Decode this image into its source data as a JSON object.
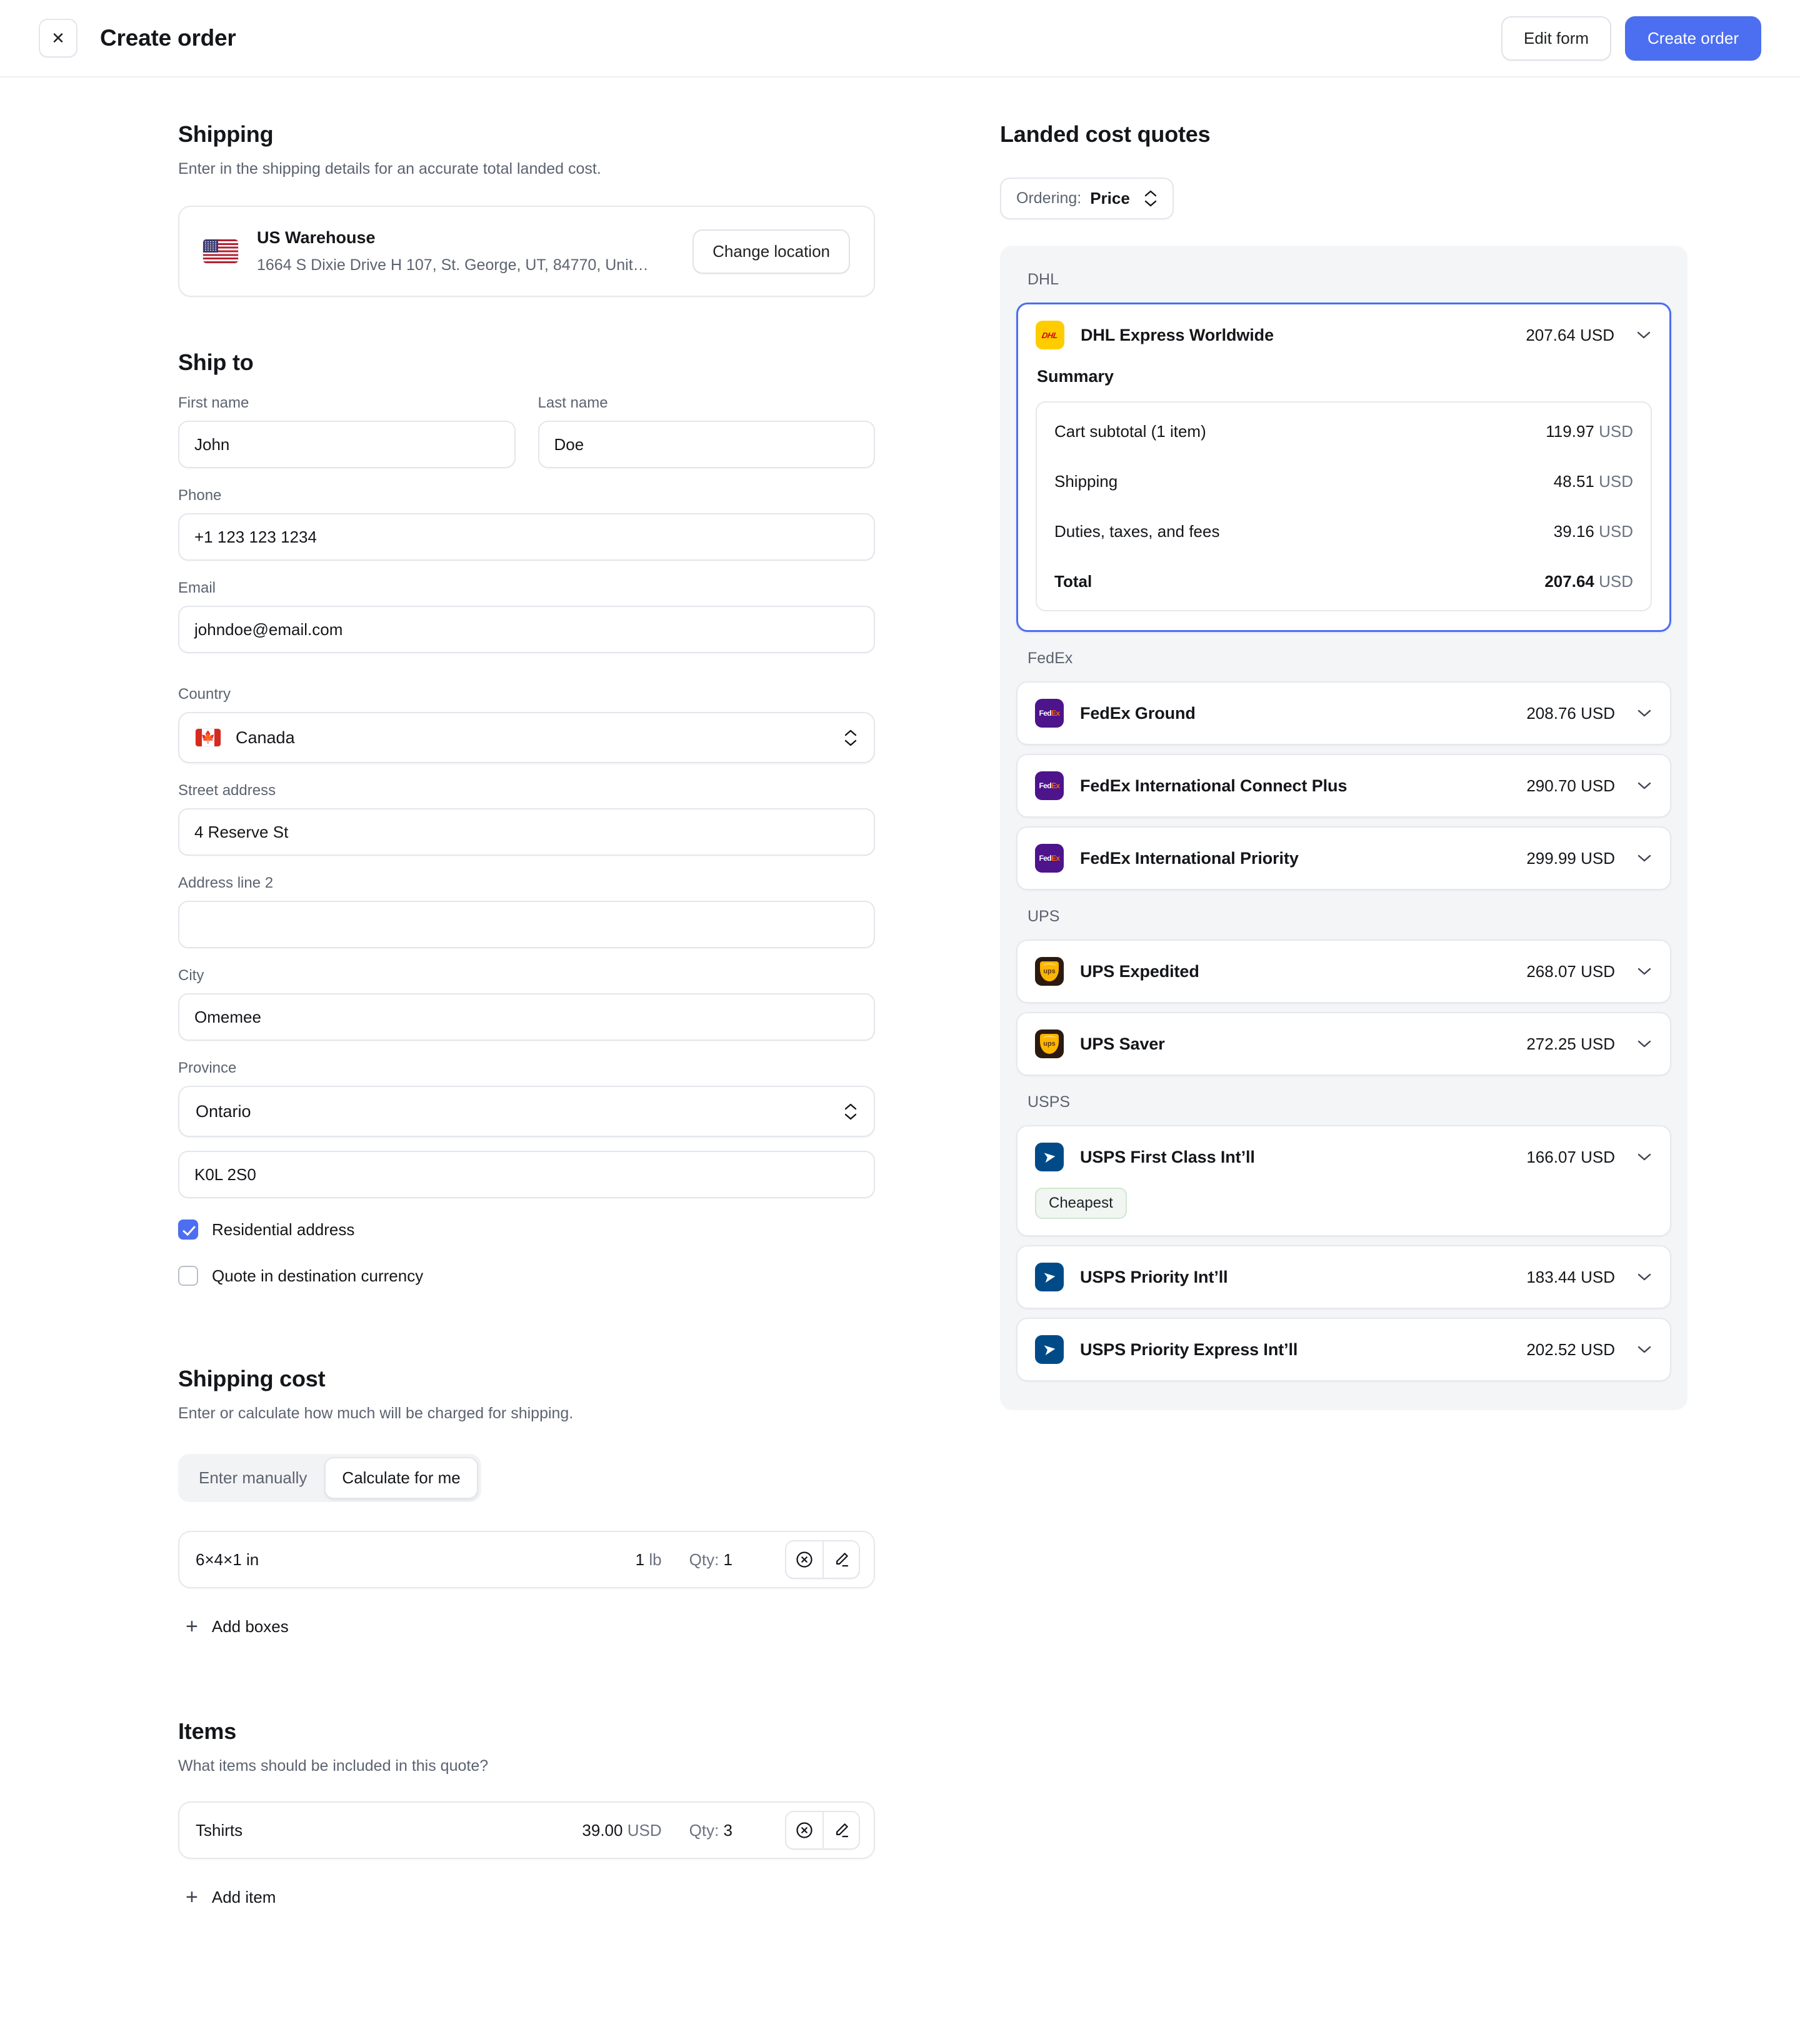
{
  "topbar": {
    "close_icon": "close-icon",
    "title": "Create order",
    "edit_form_label": "Edit form",
    "create_order_label": "Create order"
  },
  "shipping": {
    "title": "Shipping",
    "subtitle": "Enter in the shipping details for an accurate total landed cost.",
    "location": {
      "flag_icon": "us-flag-icon",
      "name": "US Warehouse",
      "address": "1664 S Dixie Drive H 107, St. George, UT, 84770, Unit…",
      "change_label": "Change location"
    }
  },
  "ship_to": {
    "title": "Ship to",
    "first_name": {
      "label": "First name",
      "value": "John"
    },
    "last_name": {
      "label": "Last name",
      "value": "Doe"
    },
    "phone": {
      "label": "Phone",
      "value": "+1 123 123 1234"
    },
    "email": {
      "label": "Email",
      "value": "johndoe@email.com"
    },
    "country": {
      "label": "Country",
      "value": "Canada",
      "flag_icon": "canada-flag-icon"
    },
    "street": {
      "label": "Street address",
      "value": "4 Reserve St"
    },
    "address2": {
      "label": "Address line 2",
      "value": ""
    },
    "city": {
      "label": "City",
      "value": "Omemee"
    },
    "province": {
      "label": "Province",
      "value": "Ontario"
    },
    "postal": {
      "label": "",
      "value": "K0L 2S0"
    },
    "residential": {
      "label": "Residential address",
      "checked": true
    },
    "destination_currency": {
      "label": "Quote in destination currency",
      "checked": false
    }
  },
  "shipping_cost": {
    "title": "Shipping cost",
    "subtitle": "Enter or calculate how much will be charged for shipping.",
    "tabs": [
      {
        "label": "Enter manually",
        "active": false
      },
      {
        "label": "Calculate for me",
        "active": true
      }
    ],
    "boxes": [
      {
        "name": "6×4×1 in",
        "weight": "1",
        "weight_unit": "lb",
        "qty_label": "Qty:",
        "qty": "1"
      }
    ],
    "add_boxes_label": "Add boxes"
  },
  "items": {
    "title": "Items",
    "subtitle": "What items should be included in this quote?",
    "rows": [
      {
        "name": "Tshirts",
        "price": "39.00",
        "currency": "USD",
        "qty_label": "Qty:",
        "qty": "3"
      }
    ],
    "add_item_label": "Add item"
  },
  "quotes": {
    "title": "Landed cost quotes",
    "ordering": {
      "label": "Ordering:",
      "value": "Price"
    },
    "groups": [
      {
        "carrier": "DHL",
        "logo": "dhl-logo-icon",
        "options": [
          {
            "name": "DHL Express Worldwide",
            "price": "207.64",
            "currency": "USD",
            "selected": true,
            "badge": "",
            "summary": {
              "title": "Summary",
              "rows": [
                {
                  "label": "Cart subtotal (1 item)",
                  "amount": "119.97",
                  "currency": "USD",
                  "total": false
                },
                {
                  "label": "Shipping",
                  "amount": "48.51",
                  "currency": "USD",
                  "total": false
                },
                {
                  "label": "Duties, taxes, and fees",
                  "amount": "39.16",
                  "currency": "USD",
                  "total": false
                },
                {
                  "label": "Total",
                  "amount": "207.64",
                  "currency": "USD",
                  "total": true
                }
              ]
            }
          }
        ]
      },
      {
        "carrier": "FedEx",
        "logo": "fedex-logo-icon",
        "options": [
          {
            "name": "FedEx Ground",
            "price": "208.76",
            "currency": "USD",
            "selected": false,
            "badge": ""
          },
          {
            "name": "FedEx International Connect Plus",
            "price": "290.70",
            "currency": "USD",
            "selected": false,
            "badge": ""
          },
          {
            "name": "FedEx International Priority",
            "price": "299.99",
            "currency": "USD",
            "selected": false,
            "badge": ""
          }
        ]
      },
      {
        "carrier": "UPS",
        "logo": "ups-logo-icon",
        "options": [
          {
            "name": "UPS Expedited",
            "price": "268.07",
            "currency": "USD",
            "selected": false,
            "badge": ""
          },
          {
            "name": "UPS Saver",
            "price": "272.25",
            "currency": "USD",
            "selected": false,
            "badge": ""
          }
        ]
      },
      {
        "carrier": "USPS",
        "logo": "usps-logo-icon",
        "options": [
          {
            "name": "USPS First Class Int’ll",
            "price": "166.07",
            "currency": "USD",
            "selected": false,
            "badge": "Cheapest"
          },
          {
            "name": "USPS Priority Int’ll",
            "price": "183.44",
            "currency": "USD",
            "selected": false,
            "badge": ""
          },
          {
            "name": "USPS Priority Express Int’ll",
            "price": "202.52",
            "currency": "USD",
            "selected": false,
            "badge": ""
          }
        ]
      }
    ]
  },
  "colors": {
    "accent": "#4c6ef0",
    "dhl": "#ffcc00",
    "fedex": "#4d148c",
    "ups": "#2b1a10",
    "usps": "#004b87",
    "badge_border": "#cfe7cf"
  }
}
